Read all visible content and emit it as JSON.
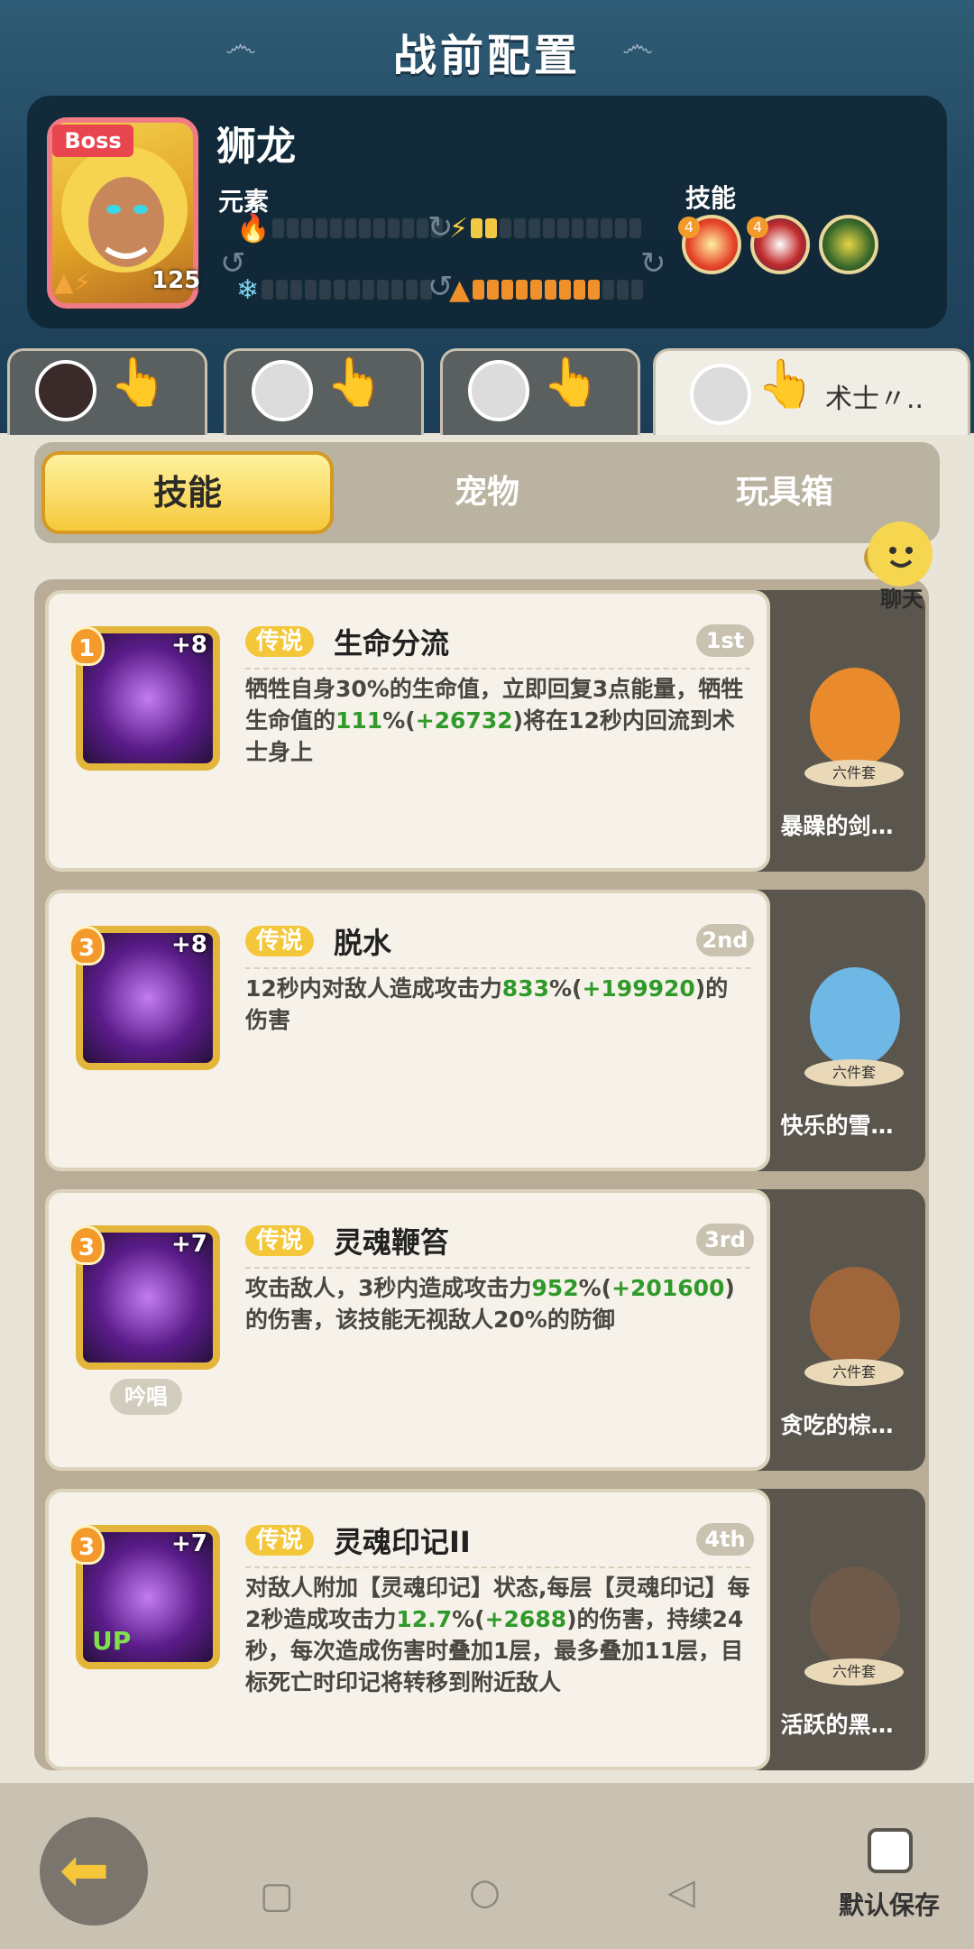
{
  "title": "战前配置",
  "boss": {
    "tag": "Boss",
    "name": "狮龙",
    "level": "125",
    "element_label": "元素",
    "skill_label": "技能",
    "skill_badges": [
      "4",
      "4"
    ],
    "elements": [
      {
        "icon": "fire-icon",
        "glyph": "🔥",
        "filled": 0,
        "total": 12,
        "color": "#f3c843"
      },
      {
        "icon": "lightning-icon",
        "glyph": "⚡",
        "filled": 2,
        "total": 12,
        "color": "#f3c843"
      },
      {
        "icon": "snowflake-icon",
        "glyph": "❄",
        "filled": 0,
        "total": 12,
        "color": "#f3c843"
      },
      {
        "icon": "mountain-icon",
        "glyph": "▲",
        "filled": 9,
        "total": 12,
        "color": "#f0902a"
      }
    ]
  },
  "heroes": {
    "active_label": "术士〃.."
  },
  "tabs": {
    "skill": "技能",
    "pet": "宠物",
    "toybox": "玩具箱"
  },
  "chat": "聊天",
  "skills": [
    {
      "badge": "1",
      "plus": "+8",
      "legend": "传说",
      "name": "生命分流",
      "rank": "1st",
      "desc": [
        {
          "t": "牺牲自身30%的生命值，立即回复3点能量，牺牲生命值的"
        },
        {
          "t": "111",
          "g": true
        },
        {
          "t": "%("
        },
        {
          "t": "+26732",
          "g": true
        },
        {
          "t": ")将在12秒内回流到术士身上"
        }
      ],
      "pet": "暴躁的剑…",
      "set": "六件套",
      "pet_color": "#e98b2d"
    },
    {
      "badge": "3",
      "plus": "+8",
      "legend": "传说",
      "name": "脱水",
      "rank": "2nd",
      "desc": [
        {
          "t": "12秒内对敌人造成攻击力"
        },
        {
          "t": "833",
          "g": true
        },
        {
          "t": "%("
        },
        {
          "t": "+199920",
          "g": true
        },
        {
          "t": ")的伤害"
        }
      ],
      "pet": "快乐的雪…",
      "set": "六件套",
      "pet_color": "#6fb8e6"
    },
    {
      "badge": "3",
      "plus": "+7",
      "legend": "传说",
      "name": "灵魂鞭笞",
      "rank": "3rd",
      "desc": [
        {
          "t": "攻击敌人，3秒内造成攻击力"
        },
        {
          "t": "952",
          "g": true
        },
        {
          "t": "%("
        },
        {
          "t": "+201600",
          "g": true
        },
        {
          "t": ")的伤害，该技能无视敌人20%的防御"
        }
      ],
      "chant": "吟唱",
      "pet": "贪吃的棕…",
      "set": "六件套",
      "pet_color": "#a0663b"
    },
    {
      "badge": "3",
      "plus": "+7",
      "legend": "传说",
      "name": "灵魂印记II",
      "rank": "4th",
      "up": "UP",
      "desc": [
        {
          "t": "对敌人附加【灵魂印记】状态,每层【灵魂印记】每2秒造成攻击力"
        },
        {
          "t": "12.7",
          "g": true
        },
        {
          "t": "%("
        },
        {
          "t": "+2688",
          "g": true
        },
        {
          "t": ")的伤害，持续24秒，每次造成伤害时叠加1层，最多叠加11层，目标死亡时印记将转移到附近敌人"
        }
      ],
      "pet": "活跃的黑…",
      "set": "六件套",
      "pet_color": "#6d5a4b"
    }
  ],
  "footer": {
    "save_label": "默认保存"
  }
}
